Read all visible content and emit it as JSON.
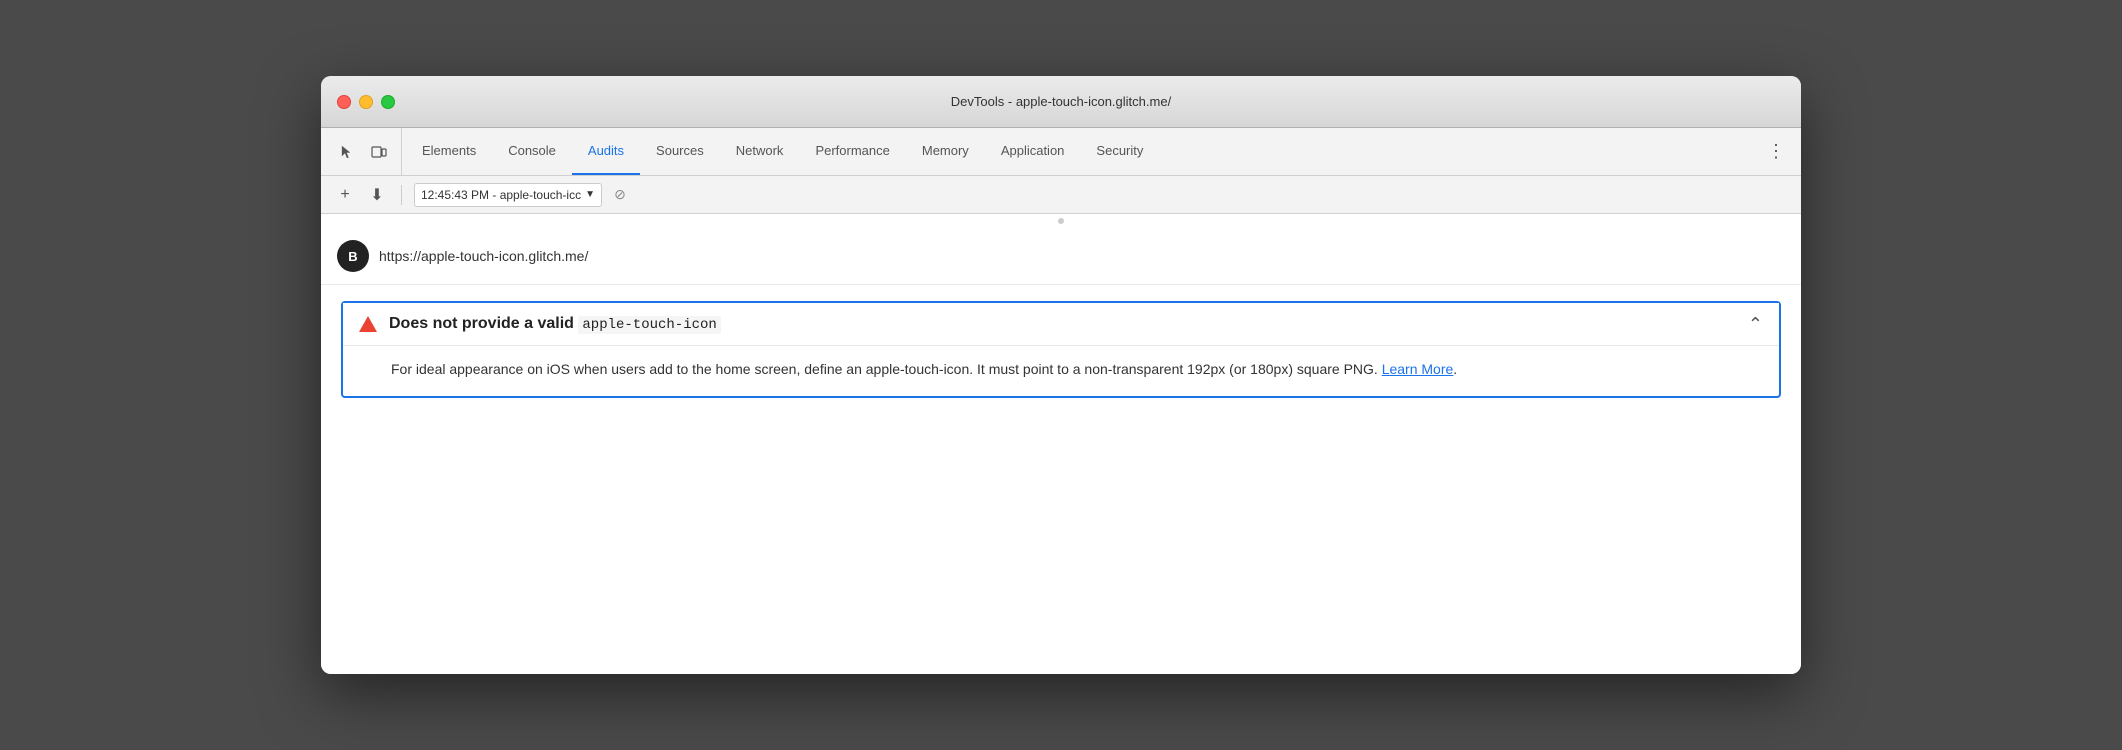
{
  "window": {
    "title": "DevTools - apple-touch-icon.glitch.me/"
  },
  "tabs": [
    {
      "id": "elements",
      "label": "Elements",
      "active": false
    },
    {
      "id": "console",
      "label": "Console",
      "active": false
    },
    {
      "id": "audits",
      "label": "Audits",
      "active": true
    },
    {
      "id": "sources",
      "label": "Sources",
      "active": false
    },
    {
      "id": "network",
      "label": "Network",
      "active": false
    },
    {
      "id": "performance",
      "label": "Performance",
      "active": false
    },
    {
      "id": "memory",
      "label": "Memory",
      "active": false
    },
    {
      "id": "application",
      "label": "Application",
      "active": false
    },
    {
      "id": "security",
      "label": "Security",
      "active": false
    }
  ],
  "secondary_toolbar": {
    "add_label": "+",
    "download_label": "⬇",
    "session_text": "12:45:43 PM - apple-touch-icc",
    "dropdown_icon": "▼",
    "no_entry_icon": "⊘"
  },
  "url_bar": {
    "site_icon_letter": "B",
    "url": "https://apple-touch-icon.glitch.me/"
  },
  "audit": {
    "warning": {
      "title_before_code": "Does not provide a valid",
      "title_code": "apple-touch-icon",
      "description": "For ideal appearance on iOS when users add to the home screen, define an apple-touch-icon. It must point to a non-transparent 192px (or 180px) square PNG.",
      "learn_more_text": "Learn More",
      "period": "."
    }
  },
  "icons": {
    "cursor": "⬆",
    "layers": "⧉",
    "more_vert": "⋮",
    "chevron_up": "⌃",
    "no_entry": "⊘"
  },
  "colors": {
    "active_tab": "#1a73e8",
    "warning_border": "#1a73e8",
    "triangle": "#ea4335",
    "link": "#1a73e8"
  }
}
